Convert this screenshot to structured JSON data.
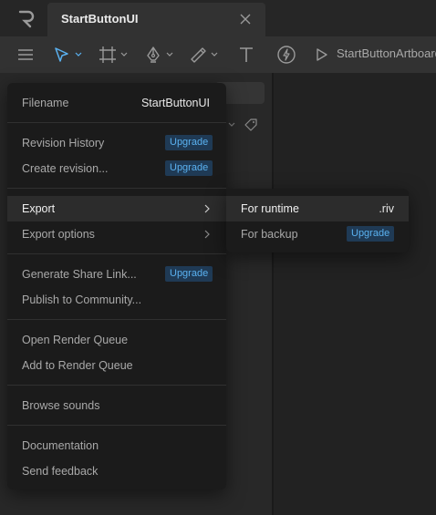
{
  "tab": {
    "title": "StartButtonUI"
  },
  "toolbar": {
    "artboard_label": "StartButtonArtboard"
  },
  "menu": {
    "filename_label": "Filename",
    "filename_value": "StartButtonUI",
    "revision_history": "Revision History",
    "create_revision": "Create revision...",
    "export": "Export",
    "export_options": "Export options",
    "generate_share_link": "Generate Share Link...",
    "publish_to_community": "Publish to Community...",
    "open_render_queue": "Open Render Queue",
    "add_to_render_queue": "Add to Render Queue",
    "browse_sounds": "Browse sounds",
    "documentation": "Documentation",
    "send_feedback": "Send feedback",
    "upgrade_label": "Upgrade"
  },
  "submenu": {
    "for_runtime": "For runtime",
    "runtime_ext": ".riv",
    "for_backup": "For backup",
    "upgrade_label": "Upgrade"
  },
  "colors": {
    "accent": "#5ab1f0",
    "badge_bg": "#1f3a55",
    "menu_bg": "#1b1b1b",
    "toolbar_bg": "#323232"
  },
  "icons": [
    "rive-logo-icon",
    "close-icon",
    "hamburger-menu-icon",
    "select-arrow-icon",
    "artboard-frame-icon",
    "pen-tool-icon",
    "brush-icon",
    "text-tool-icon",
    "lightning-icon",
    "play-icon",
    "chevron-down-icon",
    "chevron-right-icon",
    "tag-icon"
  ]
}
